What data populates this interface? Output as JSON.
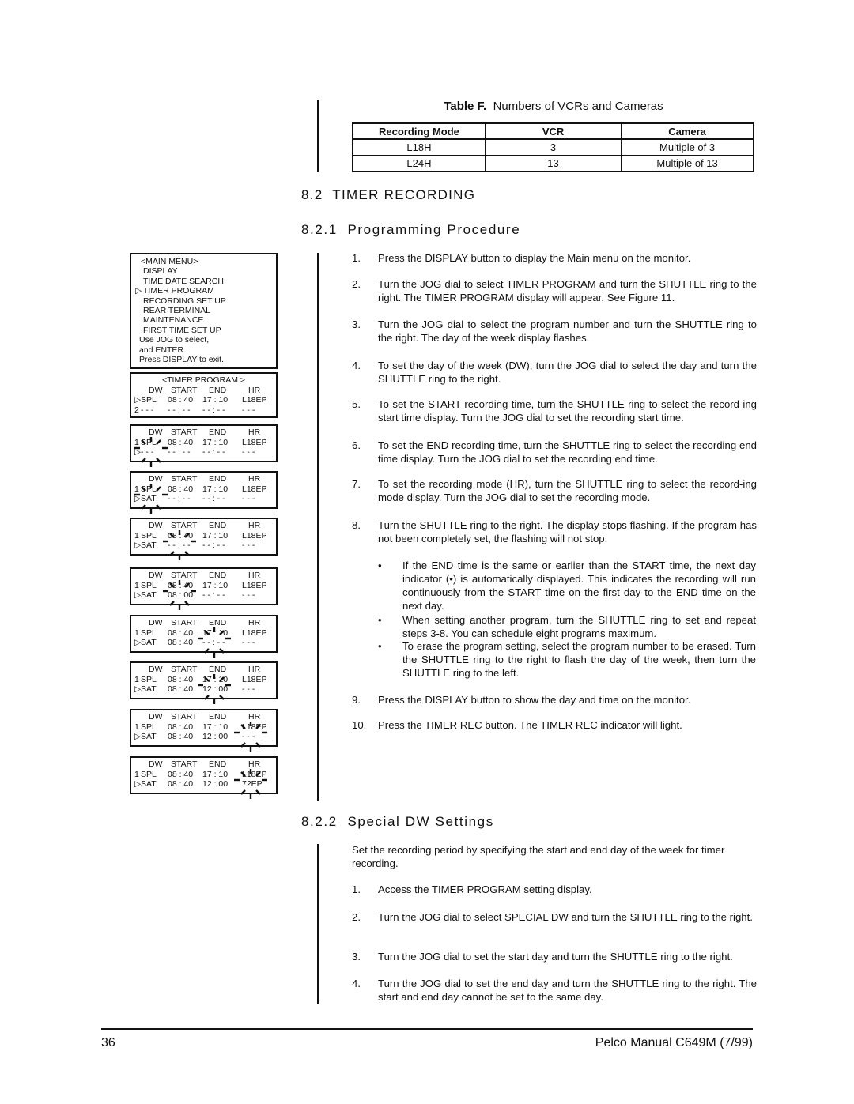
{
  "table_f": {
    "caption_label": "Table F.",
    "caption_text": "Numbers of VCRs and Cameras",
    "columns": [
      "Recording Mode",
      "VCR",
      "Camera"
    ],
    "rows": [
      [
        "L18H",
        "3",
        "Multiple of 3"
      ],
      [
        "L24H",
        "13",
        "Multiple of 13"
      ]
    ]
  },
  "section": {
    "heading": "8.2  TIMER RECORDING",
    "sub1_heading": "8.2.1  Programming Procedure",
    "sub2_heading": "8.2.2  Special DW Settings"
  },
  "procedure_steps": [
    {
      "num": "1.",
      "text": "Press the DISPLAY button to display the Main menu on the monitor."
    },
    {
      "num": "2.",
      "text": "Turn the JOG dial to select TIMER PROGRAM and turn the SHUTTLE ring to the right. The TIMER PROGRAM display will appear. See Figure 11."
    },
    {
      "num": "3.",
      "text": "Turn the JOG dial to select the program number and turn the SHUTTLE ring to the right. The day of the week display flashes."
    },
    {
      "num": "4.",
      "text": "To set the day of the week (DW), turn the JOG dial to select the day and turn the SHUTTLE ring to the right."
    },
    {
      "num": "5.",
      "text": "To set the START recording time, turn the SHUTTLE ring to select the record-ing start time display. Turn the JOG dial to set the recording start time."
    },
    {
      "num": "6.",
      "text": "To set the END recording time, turn the SHUTTLE ring to select the recording end time display. Turn the JOG dial to set the recording end time."
    },
    {
      "num": "7.",
      "text": "To set the recording mode (HR), turn the SHUTTLE ring to select the record-ing mode display. Turn the JOG dial to set the recording mode."
    },
    {
      "num": "8.",
      "text": "Turn the SHUTTLE ring to the right. The display stops flashing. If the program has not been completely set, the flashing will not stop."
    },
    {
      "num": "9.",
      "text": "Press the DISPLAY button to show the day and time on the monitor."
    },
    {
      "num": "10.",
      "text": "Press the TIMER REC button. The TIMER REC indicator will light."
    }
  ],
  "procedure_bullets": [
    {
      "dot": "•",
      "text": "If the END time is the same or earlier than the START time, the next day indicator (•) is automatically displayed. This indicates the recording will run continuously from the START time on the first day to the END time on the next day."
    },
    {
      "dot": "•",
      "text": "When setting another program, turn the SHUTTLE ring to set and repeat steps 3-8. You can schedule eight programs maximum."
    },
    {
      "dot": "•",
      "text": "To erase the program setting, select the program number to be erased. Turn the SHUTTLE ring to the right to flash the day of the week, then turn the SHUTTLE ring to the left."
    }
  ],
  "special_dw": {
    "intro": "Set the recording period by specifying the start and end day of the week for timer recording.",
    "steps": [
      {
        "num": "1.",
        "text": "Access the TIMER PROGRAM setting display."
      },
      {
        "num": "2.",
        "text": "Turn the JOG dial to select SPECIAL DW and turn the SHUTTLE ring to the right."
      },
      {
        "num": "3.",
        "text": "Turn the JOG dial to set the start day and turn the SHUTTLE ring to the right."
      },
      {
        "num": "4.",
        "text": "Turn the JOG dial to set the end day and turn the SHUTTLE ring to the right. The start and end day cannot be set to the same day."
      }
    ]
  },
  "main_menu_screen": {
    "title": "<MAIN MENU>",
    "items": [
      "DISPLAY",
      "TIME DATE SEARCH",
      "TIMER PROGRAM",
      "RECORDING SET UP",
      "REAR TERMINAL",
      "MAINTENANCE",
      "FIRST TIME SET UP"
    ],
    "selected_item": "TIMER PROGRAM",
    "cursor_glyph": "▷",
    "hints": [
      "Use JOG to select,",
      "and ENTER.",
      "Press DISPLAY to exit."
    ]
  },
  "timer_screens": [
    {
      "title": "<TIMER PROGRAM >",
      "header": [
        "DW",
        "START",
        "END",
        "HR"
      ],
      "rows": [
        [
          "▷",
          "SPL",
          "08 : 40",
          "17 : 10",
          "L18EP"
        ],
        [
          "2",
          "- - -",
          "- - : - -",
          "- - : - -",
          "- - -"
        ]
      ]
    },
    {
      "header": [
        "DW",
        "START",
        "END",
        "HR"
      ],
      "rows": [
        [
          "1",
          "SPL",
          "08 : 40",
          "17 : 10",
          "L18EP"
        ],
        [
          "▷",
          "- - -",
          "- - : - -",
          "- - : - -",
          "- - -"
        ]
      ],
      "flashing": "DW"
    },
    {
      "header": [
        "DW",
        "START",
        "END",
        "HR"
      ],
      "rows": [
        [
          "1",
          "SPL",
          "08 : 40",
          "17 : 10",
          "L18EP"
        ],
        [
          "▷",
          "SAT",
          "- - : - -",
          "- - : - -",
          "- - -"
        ]
      ],
      "flashing": "DW"
    },
    {
      "header": [
        "DW",
        "START",
        "END",
        "HR"
      ],
      "rows": [
        [
          "1",
          "SPL",
          "08 : 40",
          "17 : 10",
          "L18EP"
        ],
        [
          "▷",
          "SAT",
          "- - : - -",
          "- - : - -",
          "- - -"
        ]
      ],
      "flashing": "START"
    },
    {
      "header": [
        "DW",
        "START",
        "END",
        "HR"
      ],
      "rows": [
        [
          "1",
          "SPL",
          "08 : 40",
          "17 : 10",
          "L18EP"
        ],
        [
          "▷",
          "SAT",
          "08 : 00",
          "- - : - -",
          "- - -"
        ]
      ],
      "flashing": "START"
    },
    {
      "header": [
        "DW",
        "START",
        "END",
        "HR"
      ],
      "rows": [
        [
          "1",
          "SPL",
          "08 : 40",
          "17 : 10",
          "L18EP"
        ],
        [
          "▷",
          "SAT",
          "08 : 40",
          "- - : - -",
          "- - -"
        ]
      ],
      "flashing": "END"
    },
    {
      "header": [
        "DW",
        "START",
        "END",
        "HR"
      ],
      "rows": [
        [
          "1",
          "SPL",
          "08 : 40",
          "17 : 10",
          "L18EP"
        ],
        [
          "▷",
          "SAT",
          "08 : 40",
          "12 : 00",
          "- - -"
        ]
      ],
      "flashing": "END"
    },
    {
      "header": [
        "DW",
        "START",
        "END",
        "HR"
      ],
      "rows": [
        [
          "1",
          "SPL",
          "08 : 40",
          "17 : 10",
          "L18EP"
        ],
        [
          "▷",
          "SAT",
          "08 : 40",
          "12 : 00",
          "- - -"
        ]
      ],
      "flashing": "HR"
    },
    {
      "header": [
        "DW",
        "START",
        "END",
        "HR"
      ],
      "rows": [
        [
          "1",
          "SPL",
          "08 : 40",
          "17 : 10",
          "L18EP"
        ],
        [
          "▷",
          "SAT",
          "08 : 40",
          "12 : 00",
          "72EP"
        ]
      ],
      "flashing": "HR"
    }
  ],
  "footer": {
    "page_number": "36",
    "doc_title": "Pelco Manual C649M (7/99)"
  }
}
